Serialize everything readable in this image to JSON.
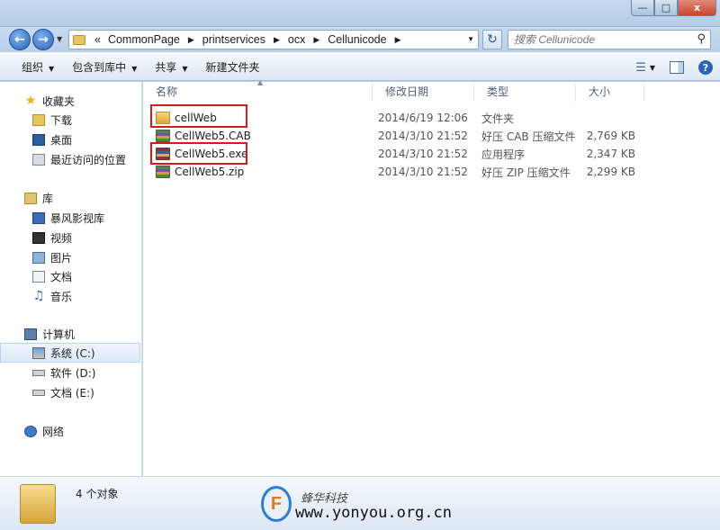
{
  "window": {
    "minimize": "—",
    "maximize": "□",
    "close": "x"
  },
  "address": {
    "prefix": "«",
    "crumbs": [
      "CommonPage",
      "printservices",
      "ocx",
      "Cellunicode"
    ],
    "search_placeholder": "搜索 Cellunicode"
  },
  "toolbar": {
    "organize": "组织",
    "include_in_library": "包含到库中",
    "share": "共享",
    "new_folder": "新建文件夹"
  },
  "sidebar": {
    "favorites": {
      "label": "收藏夹",
      "items": [
        "下载",
        "桌面",
        "最近访问的位置"
      ]
    },
    "libraries": {
      "label": "库",
      "items": [
        "暴风影视库",
        "视频",
        "图片",
        "文档",
        "音乐"
      ]
    },
    "computer": {
      "label": "计算机",
      "items": [
        "系统 (C:)",
        "软件 (D:)",
        "文档 (E:)"
      ]
    },
    "network": {
      "label": "网络"
    }
  },
  "columns": {
    "name": "名称",
    "date": "修改日期",
    "type": "类型",
    "size": "大小"
  },
  "files": [
    {
      "name": "cellWeb",
      "date": "2014/6/19 12:06",
      "type": "文件夹",
      "size": "",
      "icon": "folder-icon"
    },
    {
      "name": "CellWeb5.CAB",
      "date": "2014/3/10 21:52",
      "type": "好压 CAB 压缩文件",
      "size": "2,769 KB",
      "icon": "cab-archive-icon"
    },
    {
      "name": "CellWeb5.exe",
      "date": "2014/3/10 21:52",
      "type": "应用程序",
      "size": "2,347 KB",
      "icon": "exe-icon"
    },
    {
      "name": "CellWeb5.zip",
      "date": "2014/3/10 21:52",
      "type": "好压 ZIP 压缩文件",
      "size": "2,299 KB",
      "icon": "zip-archive-icon"
    }
  ],
  "status": {
    "count": "4 个对象"
  },
  "watermark": {
    "logo_text": "F",
    "brand": "蜂华科技",
    "url": "www.yonyou.org.cn"
  },
  "colors": {
    "highlight_box": "#d51a1a",
    "selection": "#dbe9f9",
    "chrome": "#b9d1ea"
  }
}
